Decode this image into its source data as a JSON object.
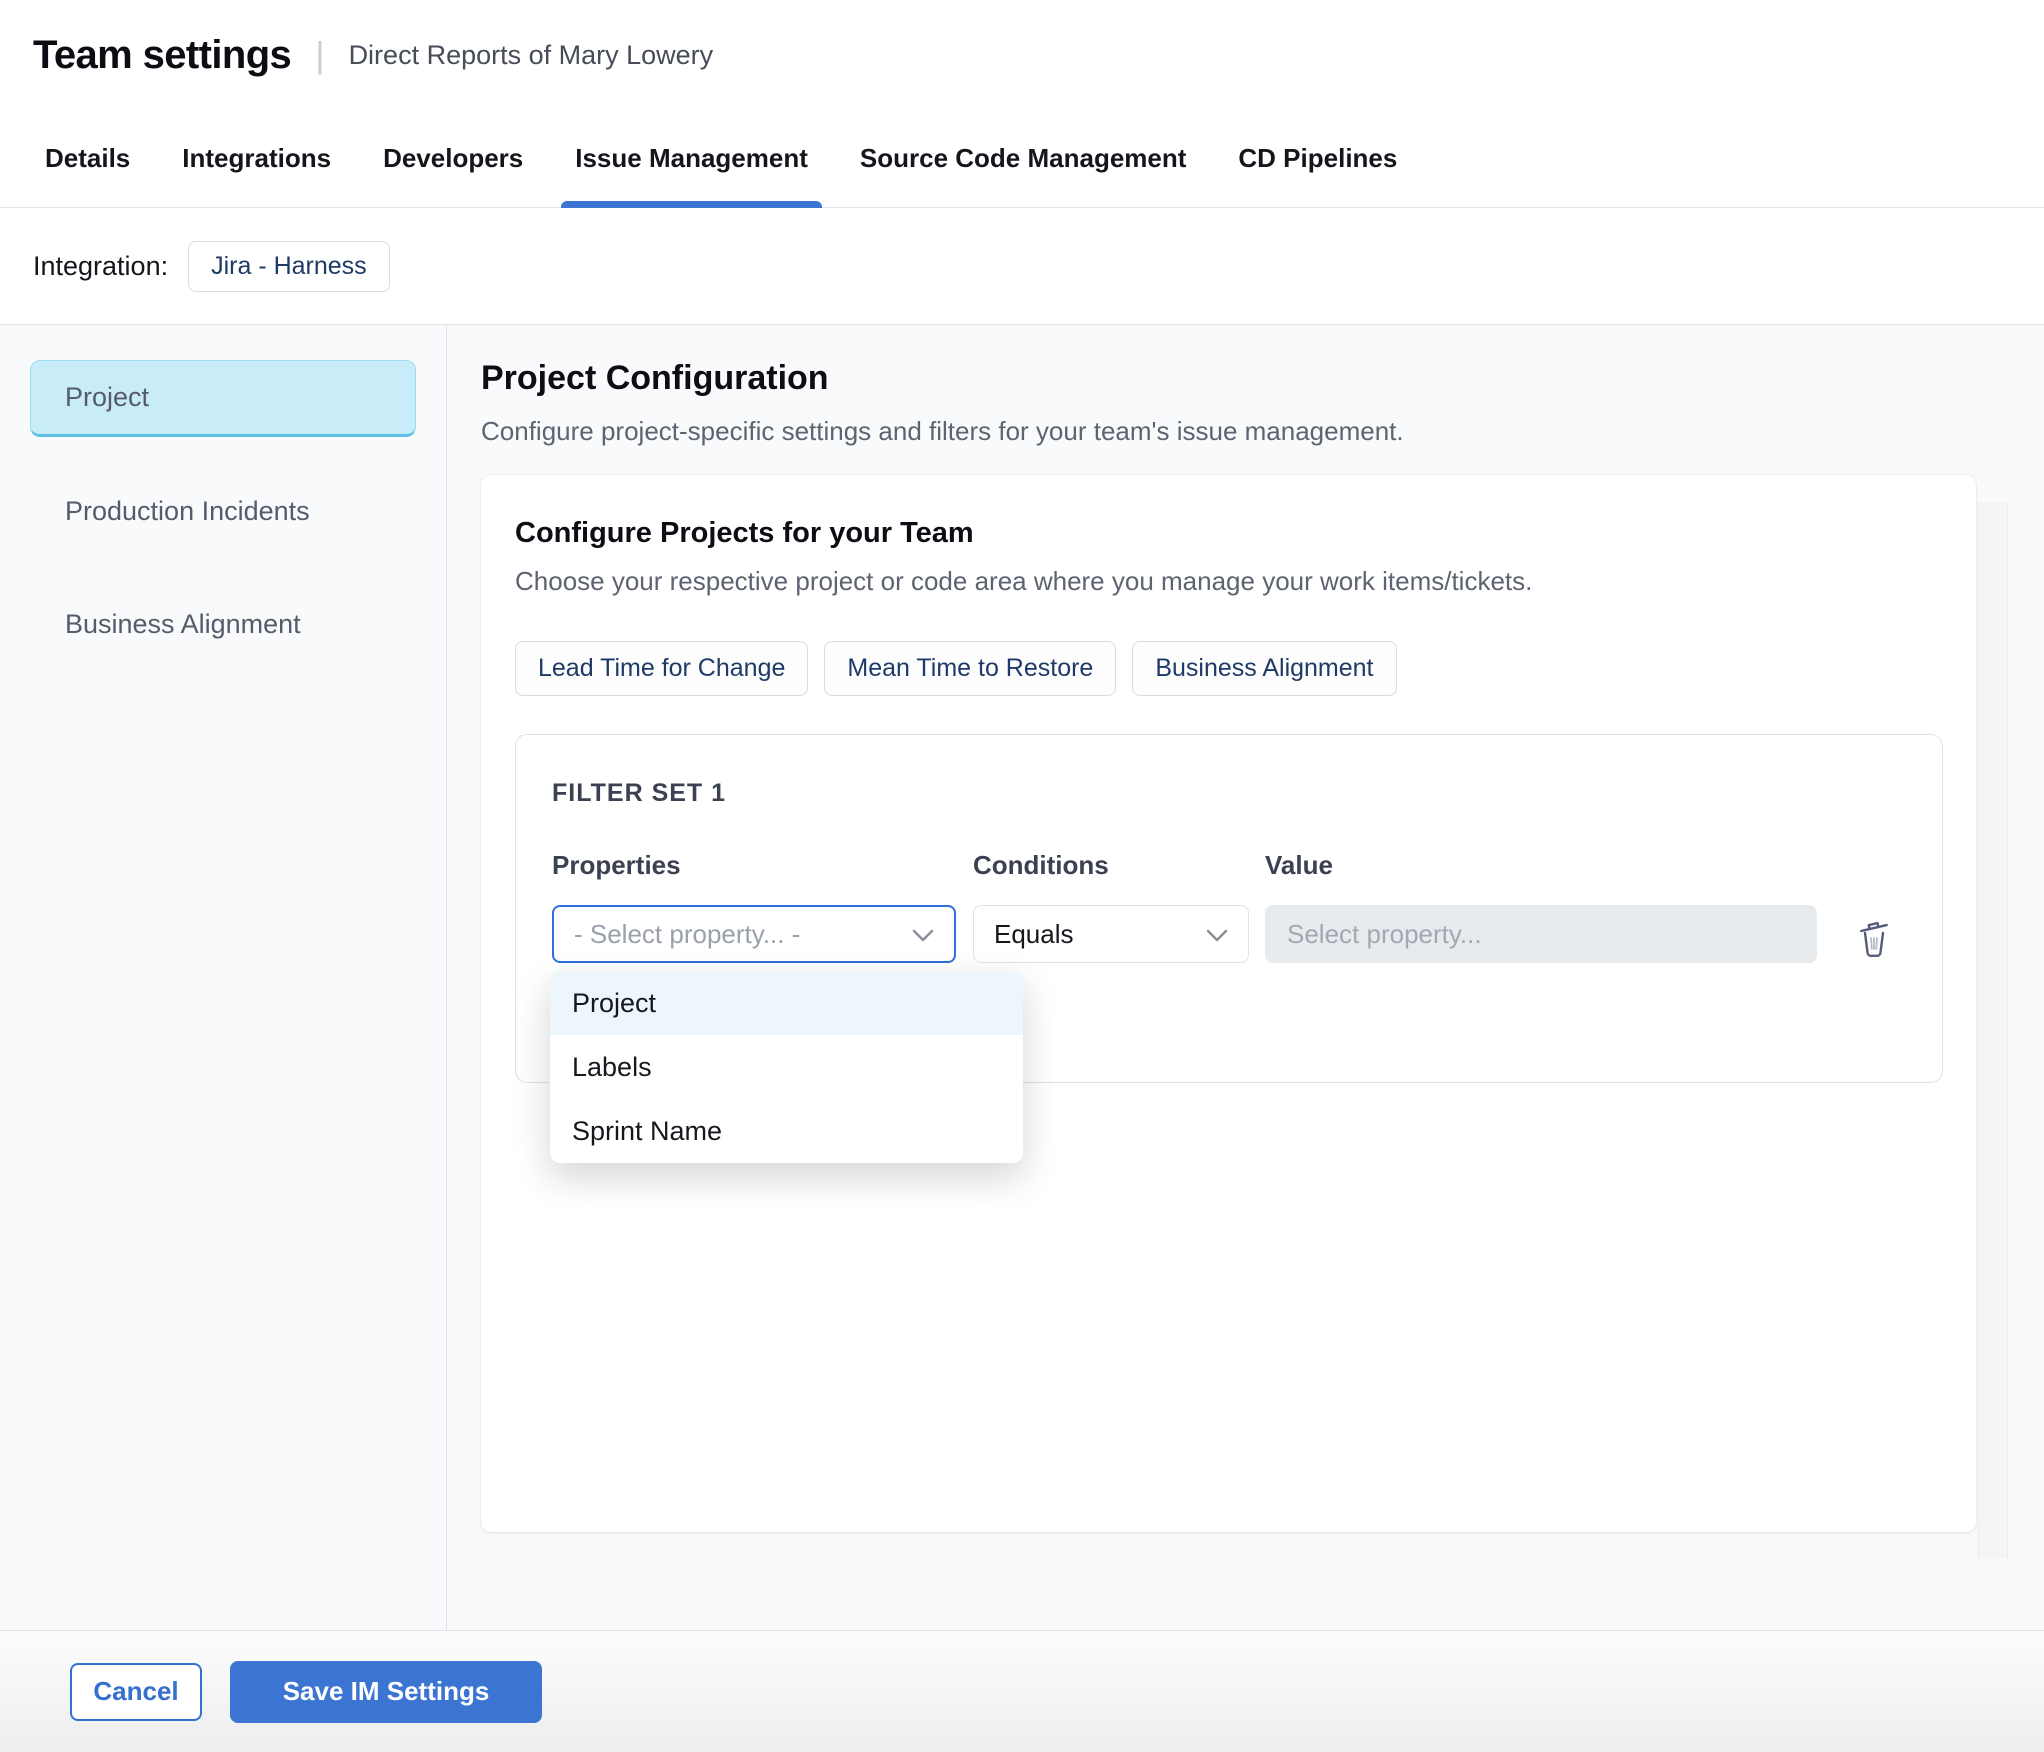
{
  "header": {
    "title": "Team settings",
    "separator": "|",
    "subtitle": "Direct Reports of Mary Lowery"
  },
  "tabs": [
    {
      "label": "Details",
      "active": false
    },
    {
      "label": "Integrations",
      "active": false
    },
    {
      "label": "Developers",
      "active": false
    },
    {
      "label": "Issue Management",
      "active": true
    },
    {
      "label": "Source Code Management",
      "active": false
    },
    {
      "label": "CD Pipelines",
      "active": false
    }
  ],
  "integration": {
    "label": "Integration:",
    "chip": "Jira - Harness"
  },
  "sidebar": {
    "items": [
      {
        "label": "Project",
        "selected": true
      },
      {
        "label": "Production Incidents",
        "selected": false
      },
      {
        "label": "Business Alignment",
        "selected": false
      }
    ]
  },
  "main": {
    "title": "Project Configuration",
    "subtitle": "Configure project-specific settings and filters for your team's issue management.",
    "card": {
      "title": "Configure Projects for your Team",
      "description": "Choose your respective project or code area where you manage your work items/tickets.",
      "metric_chips": [
        {
          "label": "Lead Time for Change"
        },
        {
          "label": "Mean Time to Restore"
        },
        {
          "label": "Business Alignment"
        }
      ],
      "filter_set": {
        "title": "FILTER SET 1",
        "columns": {
          "properties": "Properties",
          "conditions": "Conditions",
          "value": "Value"
        },
        "properties_placeholder": "- Select property... -",
        "conditions_value": "Equals",
        "value_placeholder": "Select property...",
        "dropdown_options": [
          {
            "label": "Project",
            "highlighted": true
          },
          {
            "label": "Labels",
            "highlighted": false
          },
          {
            "label": "Sprint Name",
            "highlighted": false
          }
        ]
      }
    }
  },
  "footer": {
    "cancel_label": "Cancel",
    "save_label": "Save IM Settings"
  },
  "colors": {
    "accent_blue": "#3b74d1",
    "select_focus_border": "#2e6fd9",
    "chip_text_navy": "#1e3a66",
    "sidebar_selected_bg": "#c9ecf9",
    "sidebar_selected_edge": "#5fc0e4",
    "dropdown_highlight": "#edf6fa",
    "disabled_input_bg": "#e7ebee",
    "content_bg": "#f9fafb",
    "muted_text": "#5d6370"
  }
}
